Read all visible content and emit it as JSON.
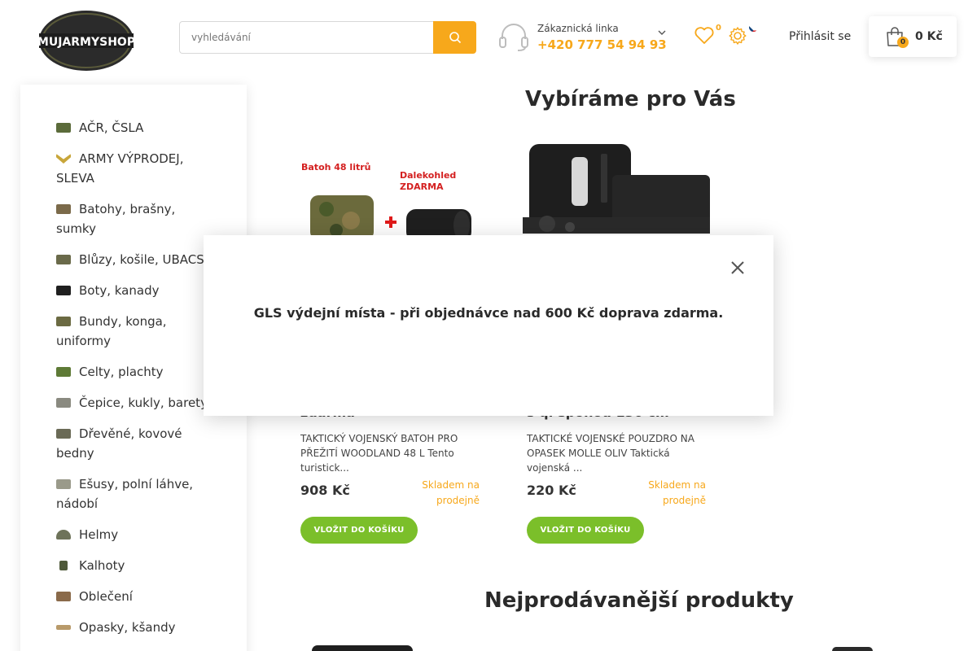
{
  "header": {
    "logo_text": "MUJARMYSHOP",
    "search_placeholder": "vyhledávání",
    "support_label": "Zákaznická linka",
    "support_phone": "+420 777 54 94 93",
    "wishlist_count": "0",
    "login_label": "Přihlásit se",
    "cart_count": "0",
    "cart_total": "0 Kč"
  },
  "sidebar": {
    "categories": [
      {
        "label": "AČR, ČSLA",
        "icon": "tank-icon"
      },
      {
        "label": "ARMY VÝPRODEJ, SLEVA",
        "icon": "chevron-rank-icon"
      },
      {
        "label": "Batohy, brašny, sumky",
        "icon": "backpack-icon"
      },
      {
        "label": "Blůzy, košile, UBACS",
        "icon": "shirt-icon"
      },
      {
        "label": "Boty, kanady",
        "icon": "boot-icon"
      },
      {
        "label": "Bundy, konga, uniformy",
        "icon": "jacket-icon"
      },
      {
        "label": "Celty, plachty",
        "icon": "tarp-icon"
      },
      {
        "label": "Čepice, kukly, barety",
        "icon": "cap-icon"
      },
      {
        "label": "Dřevěné, kovové bedny",
        "icon": "crate-icon"
      },
      {
        "label": "Ešusy, polní láhve, nádobí",
        "icon": "mess-kit-icon"
      },
      {
        "label": "Helmy",
        "icon": "helmet-icon"
      },
      {
        "label": "Kalhoty",
        "icon": "trousers-icon"
      },
      {
        "label": "Oblečení",
        "icon": "clothing-icon"
      },
      {
        "label": "Opasky, kšandy",
        "icon": "belt-icon"
      }
    ]
  },
  "main": {
    "section_title": "Vybíráme pro Vás",
    "bestsellers_title": "Nejprodávanější produkty",
    "products": [
      {
        "image_caption_1": "Batoh 48 litrů",
        "image_caption_2": "Dalekohled ZDARMA",
        "name_tail": "zdarma",
        "description": "TAKTICKÝ VOJENSKÝ BATOH PRO PŘEŽITÍ WOODLAND 48 L Tento turistick...",
        "price": "908 Kč",
        "stock": "Skladem na prodejně",
        "button": "VLOŽIT DO KOŠÍKU"
      },
      {
        "name_tail": "s q. sponou 130 cm",
        "description": "TAKTICKÉ VOJENSKÉ POUZDRO NA OPASEK MOLLE OLIV Taktická vojenská ...",
        "price": "220 Kč",
        "stock": "Skladem na prodejně",
        "button": "VLOŽIT DO KOŠÍKU"
      }
    ]
  },
  "modal": {
    "message": "GLS výdejní místa - při objednávce nad 600 Kč doprava zdarma."
  },
  "colors": {
    "accent": "#f7a81b",
    "button_green": "#7bbf2a"
  }
}
